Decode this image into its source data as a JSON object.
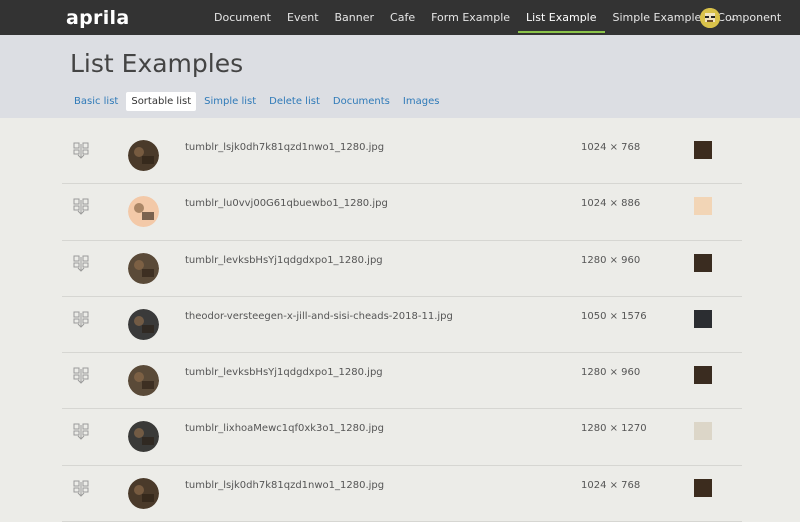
{
  "app": {
    "brand": "aprila"
  },
  "nav": {
    "items": [
      {
        "label": "Document",
        "active": false
      },
      {
        "label": "Event",
        "active": false
      },
      {
        "label": "Banner",
        "active": false
      },
      {
        "label": "Cafe",
        "active": false
      },
      {
        "label": "Form Example",
        "active": false
      },
      {
        "label": "List Example",
        "active": true
      },
      {
        "label": "Simple Example",
        "active": false
      },
      {
        "label": "Component",
        "active": false
      }
    ],
    "accent": "#8bc34a"
  },
  "page": {
    "title": "List Examples"
  },
  "tabs": [
    {
      "label": "Basic list",
      "active": false
    },
    {
      "label": "Sortable list",
      "active": true
    },
    {
      "label": "Simple list",
      "active": false
    },
    {
      "label": "Delete list",
      "active": false
    },
    {
      "label": "Documents",
      "active": false
    },
    {
      "label": "Images",
      "active": false
    }
  ],
  "rows": [
    {
      "name": "tumblr_lsjk0dh7k81qzd1nwo1_1280.jpg",
      "dims": "1024 × 768",
      "color": "#3c2c1e",
      "thumb": "#4a3a2a"
    },
    {
      "name": "tumblr_lu0vvj00G61qbuewbo1_1280.jpg",
      "dims": "1024 × 886",
      "color": "#f2d5b6",
      "thumb": "#f3c9a8"
    },
    {
      "name": "tumblr_levksbHsYj1qdgdxpo1_1280.jpg",
      "dims": "1280 × 960",
      "color": "#3a2c20",
      "thumb": "#5a4a38"
    },
    {
      "name": "theodor-versteegen-x-jill-and-sisi-cheads-2018-11.jpg",
      "dims": "1050 × 1576",
      "color": "#2b2d31",
      "thumb": "#3a3a3a"
    },
    {
      "name": "tumblr_levksbHsYj1qdgdxpo1_1280.jpg",
      "dims": "1280 × 960",
      "color": "#3a2c20",
      "thumb": "#5a4a38"
    },
    {
      "name": "tumblr_lixhoaMewc1qf0xk3o1_1280.jpg",
      "dims": "1280 × 1270",
      "color": "#dcd6c8",
      "thumb": "#3a3a38"
    },
    {
      "name": "tumblr_lsjk0dh7k81qzd1nwo1_1280.jpg",
      "dims": "1024 × 768",
      "color": "#3c2c1e",
      "thumb": "#4a3a2a"
    }
  ],
  "icons": {
    "handle": "drag-handle-icon",
    "avatar": "user-avatar",
    "chevron": "chevron-down-icon"
  }
}
